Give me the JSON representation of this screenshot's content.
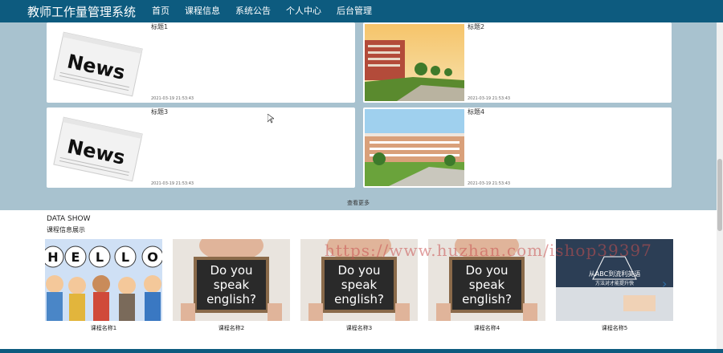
{
  "app": {
    "title": "教师工作量管理系统"
  },
  "nav": {
    "items": [
      "首页",
      "课程信息",
      "系统公告",
      "个人中心",
      "后台管理"
    ]
  },
  "news": {
    "items": [
      {
        "title": "标题1",
        "date": "2021-03-19 21:53:43",
        "image": "newspaper"
      },
      {
        "title": "标题2",
        "date": "2021-03-19 21:53:43",
        "image": "school-building"
      },
      {
        "title": "标题3",
        "date": "2021-03-19 21:53:43",
        "image": "newspaper"
      },
      {
        "title": "标题4",
        "date": "2021-03-19 21:53:43",
        "image": "school-courtyard"
      }
    ],
    "more_label": "查看更多"
  },
  "data_show": {
    "title": "DATA SHOW",
    "subtitle": "课程信息展示",
    "courses": [
      {
        "name": "课程名称1",
        "image": "hello-kids"
      },
      {
        "name": "课程名称2",
        "image": "do-you-speak-english"
      },
      {
        "name": "课程名称3",
        "image": "do-you-speak-english"
      },
      {
        "name": "课程名称4",
        "image": "do-you-speak-english"
      },
      {
        "name": "课程名称5",
        "image": "abc-english"
      }
    ]
  },
  "watermark": "https://www.huzhan.com/ishop39397",
  "images": {
    "newspaper_text": "News",
    "chalkboard_lines": [
      "Do you",
      "speak",
      "english?"
    ],
    "abc_lines": [
      "从ABC到流利英语",
      "方法对才能提升快"
    ],
    "hello_letters": [
      "H",
      "E",
      "L",
      "L",
      "O"
    ]
  },
  "colors": {
    "nav_bg": "#0d5b7f",
    "section_bg": "#a8c2cf"
  }
}
